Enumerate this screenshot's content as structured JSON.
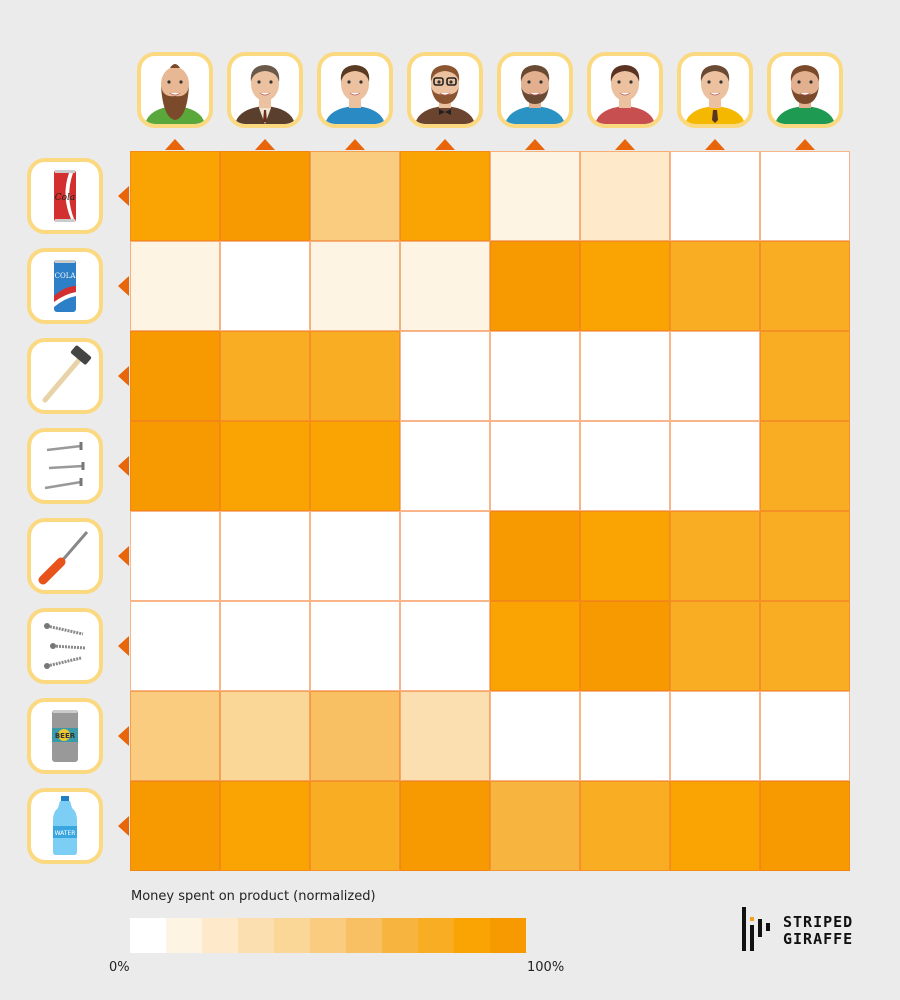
{
  "chart_data": {
    "type": "heatmap",
    "title": "",
    "columns": [
      {
        "name": "customer-1",
        "icon": "bald-bearded-man-green-shirt-avatar"
      },
      {
        "name": "customer-2",
        "icon": "businessman-suit-tie-avatar"
      },
      {
        "name": "customer-3",
        "icon": "young-man-blue-shirt-avatar"
      },
      {
        "name": "customer-4",
        "icon": "hipster-glasses-bowtie-avatar"
      },
      {
        "name": "customer-5",
        "icon": "bearded-man-blue-shirt-avatar"
      },
      {
        "name": "customer-6",
        "icon": "man-red-shirt-avatar"
      },
      {
        "name": "customer-7",
        "icon": "man-yellow-shirt-tie-avatar"
      },
      {
        "name": "customer-8",
        "icon": "bearded-man-green-striped-shirt-avatar"
      }
    ],
    "rows": [
      {
        "name": "red-cola",
        "icon": "red-cola-can-icon",
        "label": "Cola"
      },
      {
        "name": "blue-cola",
        "icon": "blue-cola-can-icon",
        "label": "COLA"
      },
      {
        "name": "hammer",
        "icon": "hammer-icon"
      },
      {
        "name": "nails",
        "icon": "nails-icon"
      },
      {
        "name": "screwdriver",
        "icon": "screwdriver-icon"
      },
      {
        "name": "screws",
        "icon": "screws-icon"
      },
      {
        "name": "beer",
        "icon": "beer-can-icon",
        "label": "BEER"
      },
      {
        "name": "water",
        "icon": "water-bottle-icon",
        "label": "WATER"
      }
    ],
    "values": [
      [
        0.9,
        1.0,
        0.5,
        0.9,
        0.1,
        0.2,
        0.0,
        0.0
      ],
      [
        0.1,
        0.0,
        0.1,
        0.1,
        1.0,
        0.9,
        0.8,
        0.8
      ],
      [
        1.0,
        0.8,
        0.8,
        0.0,
        0.0,
        0.0,
        0.0,
        0.8
      ],
      [
        1.0,
        0.9,
        0.9,
        0.0,
        0.0,
        0.0,
        0.0,
        0.8
      ],
      [
        0.0,
        0.0,
        0.0,
        0.0,
        1.0,
        0.9,
        0.8,
        0.8
      ],
      [
        0.0,
        0.0,
        0.0,
        0.0,
        0.9,
        1.0,
        0.8,
        0.8
      ],
      [
        0.5,
        0.4,
        0.6,
        0.3,
        0.0,
        0.0,
        0.0,
        0.0
      ],
      [
        1.0,
        0.9,
        0.8,
        1.0,
        0.7,
        0.8,
        0.9,
        1.0
      ]
    ],
    "value_range": [
      0,
      1
    ],
    "legend": {
      "title": "Money spent on product (normalized)",
      "min_label": "0%",
      "max_label": "100%",
      "steps": [
        0,
        0.1,
        0.2,
        0.3,
        0.4,
        0.5,
        0.6,
        0.7,
        0.8,
        0.9,
        1.0
      ],
      "colors": [
        "#ffffff",
        "#fef4e3",
        "#feeacb",
        "#fcdfb0",
        "#fbd797",
        "#f9cc80",
        "#f8c063",
        "#f7b43f",
        "#f9ad23",
        "#f9a403",
        "#f79900"
      ]
    }
  },
  "colors": {
    "background": "#ebebeb",
    "frame_border": "#fbd980",
    "arrow": "#e8650a",
    "accent": "#f7a11a"
  },
  "brand": {
    "line1": "STRIPED",
    "line2": "GIRAFFE"
  }
}
